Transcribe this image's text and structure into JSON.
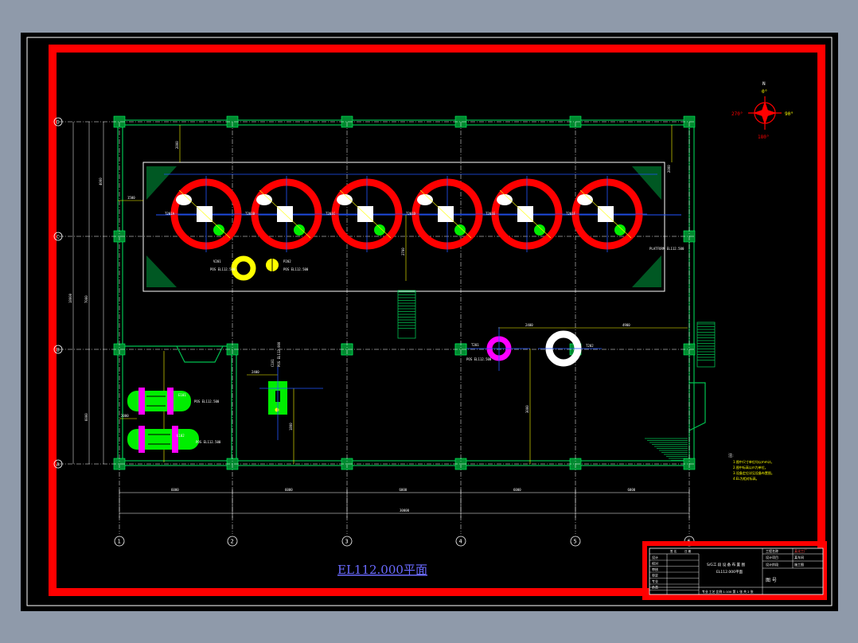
{
  "plan_title": "EL112.000平面",
  "compass": {
    "north": "N",
    "deg0": "0°",
    "deg90": "90°",
    "deg180": "180°",
    "deg270": "270°"
  },
  "grid_cols": [
    "1",
    "2",
    "3",
    "4",
    "5",
    "6"
  ],
  "grid_rows": [
    "D",
    "C",
    "B",
    "A"
  ],
  "dim_labels": {
    "top_left": "2000",
    "top_right": "2000",
    "left_total": "18000",
    "left_mid": "7000",
    "left_lower": "6000",
    "left_upper": "4000",
    "bot_1": "6000",
    "bot_2": "6000",
    "bot_3": "6000",
    "bot_4": "6000",
    "bot_5": "6000",
    "bot_total": "30000",
    "pump_spacing": "2000",
    "h_dim": "1500",
    "mid_dim": "2700",
    "eq_span1": "2400",
    "eq_span2": "4900",
    "eq_v": "3000",
    "box_dim": "2400",
    "box_v": "1800"
  },
  "tanks": [
    {
      "tag": "T201A"
    },
    {
      "tag": "T201B"
    },
    {
      "tag": "T201C"
    },
    {
      "tag": "T201D"
    },
    {
      "tag": "T201E"
    },
    {
      "tag": "T201F"
    }
  ],
  "equipment": {
    "left_pump": "V201",
    "left_pump_pos": "POS EL112.500",
    "right_pump": "P202",
    "right_pump_pos": "POS EL112.500",
    "magenta_ring": "T201",
    "magenta_pos": "POS EL112.500",
    "white_ring": "T202",
    "green_box": "C101",
    "green_box_pos": "POS EL112.000",
    "hx1": "E101",
    "hx1_pos": "POS EL112.500",
    "hx2": "E102",
    "hx2_pos": "POS EL112.500",
    "platform": "PLATFORM EL112.500"
  },
  "notes": {
    "title": "注:",
    "lines": [
      "1.图中尺寸单位均以mm计。",
      "2.图中标高以m为单位。",
      "3.设备定位详见设备布置图。",
      "4.EL为相对标高。"
    ]
  },
  "title_block": {
    "project_label": "工程名称",
    "project_value": "某化工厂",
    "design_label": "设计项目",
    "design_value": "某车间",
    "stage_label": "设计阶段",
    "stage_value": "施工图",
    "drawing_name": "S/G工 段 设 备 布 置 图",
    "drawing_sub": "EL112.000平面",
    "drawing_no_label": "图 号",
    "roles": [
      "设计",
      "校对",
      "审核",
      "审定",
      "专业",
      "负责"
    ],
    "header_cells": [
      "签 名",
      "日 期"
    ],
    "footer": "专业 工艺  比例 1:100    第 1 张  共 2 张"
  }
}
